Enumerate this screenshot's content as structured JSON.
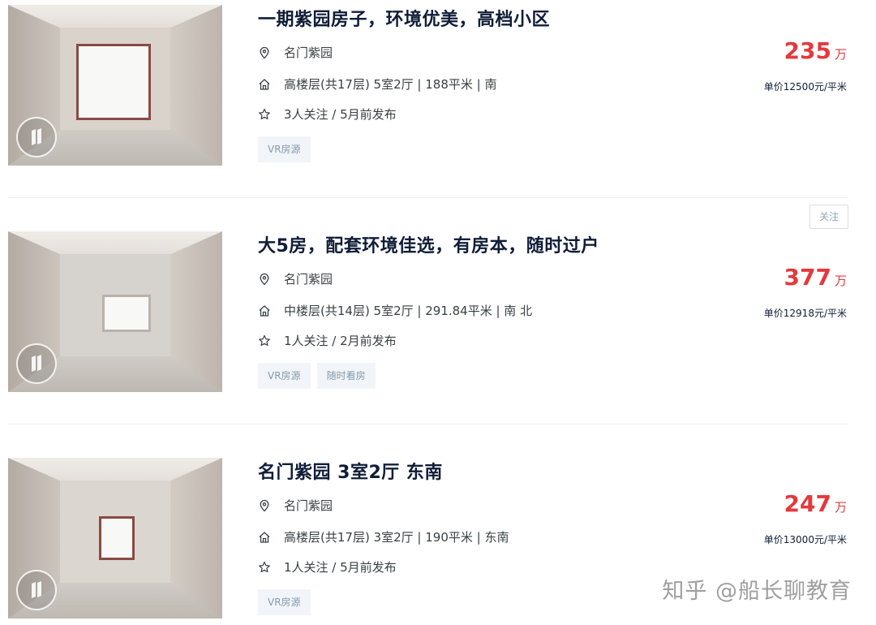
{
  "colors": {
    "price": "#e4393c",
    "title": "#101d37",
    "tag_bg": "#f1f4f8",
    "tag_text": "#849aae"
  },
  "icons": {
    "location": "location-pin-icon",
    "house": "house-icon",
    "star": "star-icon",
    "vr": "vr-logo-icon"
  },
  "follow_label": "关注",
  "watermark": "知乎 @船长聊教育",
  "listings": [
    {
      "title": "一期紫园房子，环境优美，高档小区",
      "community": "名门紫园",
      "info": "高楼层(共17层) 5室2厅 | 188平米 | 南",
      "follow": "3人关注 / 5月前发布",
      "tags": [
        "VR房源"
      ],
      "price": "235",
      "price_unit": "万",
      "unit_price": "单价12500元/平米"
    },
    {
      "title": "大5房，配套环境佳选，有房本，随时过户",
      "community": "名门紫园",
      "info": "中楼层(共14层) 5室2厅 | 291.84平米 | 南 北",
      "follow": "1人关注 / 2月前发布",
      "tags": [
        "VR房源",
        "随时看房"
      ],
      "price": "377",
      "price_unit": "万",
      "unit_price": "单价12918元/平米"
    },
    {
      "title": "名门紫园 3室2厅 东南",
      "community": "名门紫园",
      "info": "高楼层(共17层) 3室2厅 | 190平米 | 东南",
      "follow": "1人关注 / 5月前发布",
      "tags": [
        "VR房源"
      ],
      "price": "247",
      "price_unit": "万",
      "unit_price": "单价13000元/平米"
    }
  ]
}
